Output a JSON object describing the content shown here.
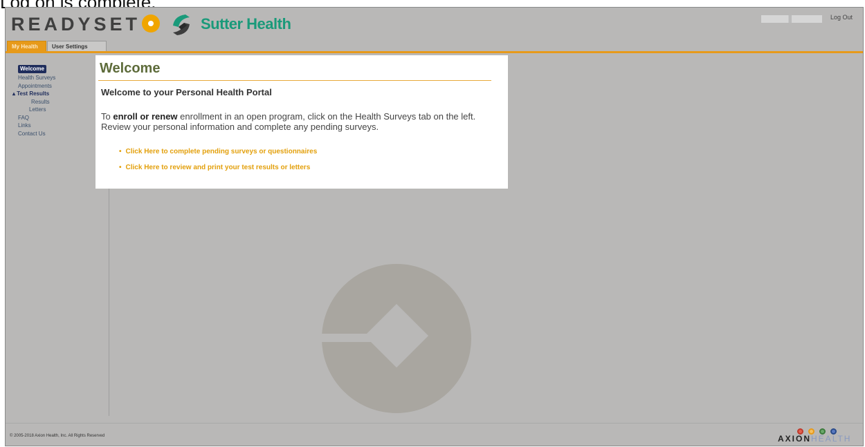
{
  "caption": "Log on is complete.",
  "header": {
    "brand_text": "READYSET",
    "partner_name": "Sutter Health",
    "logout_label": "Log Out"
  },
  "tabs": [
    {
      "label": "My Health",
      "active": true
    },
    {
      "label": "User Settings",
      "active": false
    }
  ],
  "sidebar": {
    "items": [
      {
        "label": "Welcome",
        "selected": true
      },
      {
        "label": "Health Surveys"
      },
      {
        "label": "Appointments"
      },
      {
        "label": "▴ Test Results",
        "expanded": true
      },
      {
        "label": "Results",
        "child": true
      },
      {
        "label": "Letters",
        "child": true
      },
      {
        "label": "FAQ"
      },
      {
        "label": "Links"
      },
      {
        "label": "Contact Us"
      }
    ]
  },
  "main": {
    "title": "Welcome",
    "subtitle": "Welcome to your Personal Health Portal",
    "body_prefix": "To ",
    "body_bold1": "enroll or renew",
    "body_mid": " enrollment in an open program, click on the Health Surveys tab on the left. Review your personal information and complete any pending surveys.",
    "links": [
      "Click Here to complete pending surveys or questionnaires",
      "Click Here to review and print your test results or letters"
    ]
  },
  "footer": {
    "copyright": "© 2005-2018 Axion Health, Inc. All Rights Reserved",
    "axion_bold": "AXION",
    "axion_light": "HEALTH"
  },
  "colors": {
    "accent": "#e79a1a",
    "frame_bg": "#b9b8b7",
    "nav_selected": "#1f2d5c",
    "sutter_green": "#1a9a7a",
    "link": "#e3a00c"
  }
}
